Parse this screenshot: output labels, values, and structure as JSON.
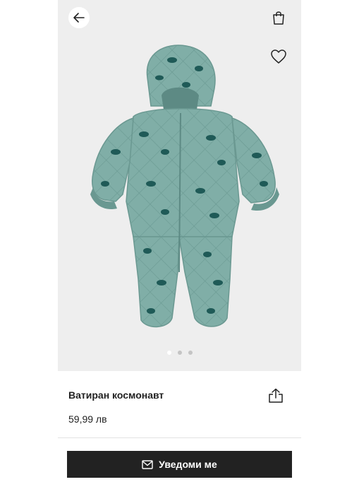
{
  "product": {
    "title": "Ватиран космонавт",
    "price": "59,99 лв",
    "image_icon": "snowsuit-image",
    "colors": {
      "fabric": "#7fada6",
      "fabric_shade": "#6a9891",
      "print": "#1f5a57",
      "background": "#eeeeee"
    }
  },
  "gallery": {
    "slide_count": 3,
    "active_index": 0
  },
  "actions": {
    "notify_label": "Уведоми ме",
    "button_color": "#222222"
  },
  "icons": {
    "back": "arrow-left-icon",
    "bag": "shopping-bag-icon",
    "favorite": "heart-icon",
    "share": "share-icon",
    "mail": "envelope-icon"
  }
}
